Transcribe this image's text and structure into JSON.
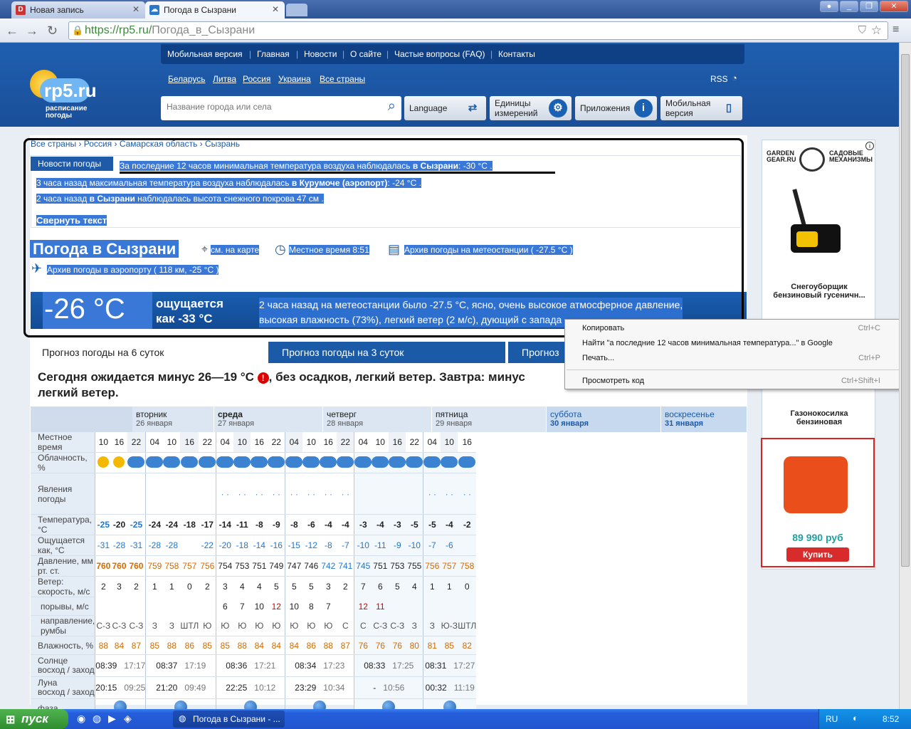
{
  "browser": {
    "tabs": [
      {
        "label": "Новая запись",
        "favicon": "D"
      },
      {
        "label": "Погода в Сызрани"
      }
    ],
    "url_host": "https://rp5.ru/",
    "url_path": "Погода_в_Сызрани"
  },
  "site": {
    "logo": "rp5.ru",
    "logo_sub1": "расписание",
    "logo_sub2": "погоды",
    "menu": [
      "Мобильная версия",
      "Главная",
      "Новости",
      "О сайте",
      "Частые вопросы (FAQ)",
      "Контакты"
    ],
    "countries": [
      "Беларусь",
      "Литва",
      "Россия",
      "Украина",
      "Все страны"
    ],
    "rss": "RSS",
    "search_placeholder": "Название города или села",
    "buttons": {
      "language": "Language",
      "units1": "Единицы",
      "units2": "измерений",
      "apps": "Приложения",
      "mobile1": "Мобильная",
      "mobile2": "версия"
    }
  },
  "breadcrumb": [
    "Все страны",
    "Россия",
    "Самарская область",
    "Сызрань"
  ],
  "news": {
    "tab": "Новости погоды",
    "line1_a": "За последние 12 часов минимальная температура воздуха наблюдалась ",
    "line1_b": "в Сызрани",
    ": -30 °C .": "",
    "line1_c": ": -30 °C .",
    "line2_a": "3 часа назад максимальная температура воздуха наблюдалась ",
    "line2_b": "в Курумоче (аэропорт)",
    "line2_c": ": -24 °C .",
    "line3_a": "2 часа назад ",
    "line3_b": "в Сызрани",
    "line3_c": " наблюдалась высота снежного покрова 47 см .",
    "collapse": "Свернуть текст"
  },
  "heading": {
    "title": "Погода в Сызрани",
    "map": "см. на карте",
    "local_time": "Местное время  8:51",
    "archive_station": "Архив погоды на метеостанции ( -27.5 °C )",
    "archive_airport": "Архив погоды в аэропорту ( 118 км, -25 °C )"
  },
  "current": {
    "temp": "-26 °C",
    "feels1": "ощущается",
    "feels2": "как -33 °C",
    "desc1": "2 часа назад на метеостанции было -27.5 °C, ясно, очень высокое атмосферное давление,",
    "desc2": "высокая влажность (73%), легкий ветер (2 м/с), дующий с запада"
  },
  "forecast_tabs": [
    "Прогноз погоды на 6 суток",
    "Прогноз погоды на 3 суток",
    "Прогноз"
  ],
  "summary1": "Сегодня ожидается минус 26—19 °C",
  "summary2": ", без осадков, легкий ветер. Завтра: минус",
  "summary3": "легкий ветер.",
  "days": [
    {
      "name": "вторник",
      "date": "26 января"
    },
    {
      "name": "среда",
      "date": "27 января"
    },
    {
      "name": "четверг",
      "date": "28 января"
    },
    {
      "name": "пятница",
      "date": "29 января"
    },
    {
      "name": "суббота",
      "date": "30 января"
    },
    {
      "name": "воскресенье",
      "date": "31 января"
    }
  ],
  "row_labels": {
    "time": "Местное время",
    "cloud": "Облачность, %",
    "phen": "Явления погоды",
    "temp": "Температура, °С",
    "feels": "Ощущается как, °С",
    "pressure": "Давление, мм рт. ст.",
    "wind": "Ветер: скорость, м/с",
    "gusts": "порывы, м/с",
    "dir": "направление, румбы",
    "humidity": "Влажность, %",
    "sun": "Солнце",
    "rise_set": "восход / заход",
    "moon": "Луна",
    "phase": "фаза"
  },
  "table": {
    "time": [
      "10",
      "16",
      "22",
      "04",
      "10",
      "16",
      "22",
      "04",
      "10",
      "16",
      "22",
      "04",
      "10",
      "16",
      "22",
      "04",
      "10",
      "16",
      "22",
      "04",
      "10",
      "16"
    ],
    "temp": [
      "-25",
      "-20",
      "-25",
      "-24",
      "-24",
      "-18",
      "-17",
      "-14",
      "-11",
      "-8",
      "-9",
      "-8",
      "-6",
      "-4",
      "-4",
      "-3",
      "-4",
      "-3",
      "-5",
      "-5",
      "-4",
      "-2"
    ],
    "feels": [
      "-31",
      "-28",
      "-31",
      "-28",
      "-28",
      "",
      "-22",
      "-20",
      "-18",
      "-14",
      "-16",
      "-15",
      "-12",
      "-8",
      "-7",
      "-10",
      "-11",
      "-9",
      "-10",
      "-7",
      "-6",
      ""
    ],
    "pressure": [
      "760",
      "760",
      "760",
      "759",
      "758",
      "757",
      "756",
      "754",
      "753",
      "751",
      "749",
      "747",
      "746",
      "742",
      "741",
      "745",
      "751",
      "753",
      "755",
      "756",
      "757",
      "758"
    ],
    "wind": [
      "2",
      "3",
      "2",
      "1",
      "1",
      "0",
      "2",
      "3",
      "4",
      "4",
      "5",
      "5",
      "5",
      "3",
      "2",
      "7",
      "6",
      "5",
      "4",
      "1",
      "1",
      "0"
    ],
    "gusts": [
      "",
      "",
      "",
      "",
      "",
      "",
      "",
      "6",
      "7",
      "10",
      "12",
      "10",
      "8",
      "7",
      "",
      "12",
      "11",
      "",
      "",
      "",
      "",
      ""
    ],
    "dir": [
      "С-З",
      "С-З",
      "С-З",
      "З",
      "З",
      "ШТЛ",
      "Ю",
      "Ю",
      "Ю",
      "Ю",
      "Ю",
      "Ю",
      "Ю",
      "Ю",
      "С",
      "С",
      "С-З",
      "С-З",
      "З",
      "З",
      "Ю-З",
      "ШТЛ"
    ],
    "humidity": [
      "88",
      "84",
      "87",
      "85",
      "88",
      "86",
      "85",
      "85",
      "88",
      "84",
      "84",
      "84",
      "86",
      "88",
      "87",
      "76",
      "76",
      "76",
      "80",
      "81",
      "85",
      "82"
    ],
    "sun": [
      [
        "08:39",
        "17:17"
      ],
      [
        "08:37",
        "17:19"
      ],
      [
        "08:36",
        "17:21"
      ],
      [
        "08:34",
        "17:23"
      ],
      [
        "08:33",
        "17:25"
      ],
      [
        "08:31",
        "17:27"
      ]
    ],
    "moon": [
      [
        "20:15",
        "09:25"
      ],
      [
        "21:20",
        "09:49"
      ],
      [
        "22:25",
        "10:12"
      ],
      [
        "23:29",
        "10:34"
      ],
      [
        "-",
        "10:56"
      ],
      [
        "00:32",
        "11:19"
      ]
    ]
  },
  "ad": {
    "brand": "GARDEN GEAR.RU",
    "brand2": "САДОВЫЕ МЕХАНИЗМЫ",
    "item1": "Снегоуборщик бензиновый гусеничн...",
    "item2": "Газонокосилка бензиновая",
    "price": "89 990 руб",
    "buy": "Купить"
  },
  "context_menu": [
    {
      "label": "Копировать",
      "shortcut": "Ctrl+C"
    },
    {
      "label": "Найти \"а последние 12 часов минимальная температура...\" в Google",
      "shortcut": ""
    },
    {
      "label": "Печать...",
      "shortcut": "Ctrl+P"
    },
    {
      "label": "Просмотреть код",
      "shortcut": "Ctrl+Shift+I"
    }
  ],
  "taskbar": {
    "start": "пуск",
    "window": "Погода в Сызрани - ...",
    "lang": "RU",
    "clock": "8:52"
  }
}
